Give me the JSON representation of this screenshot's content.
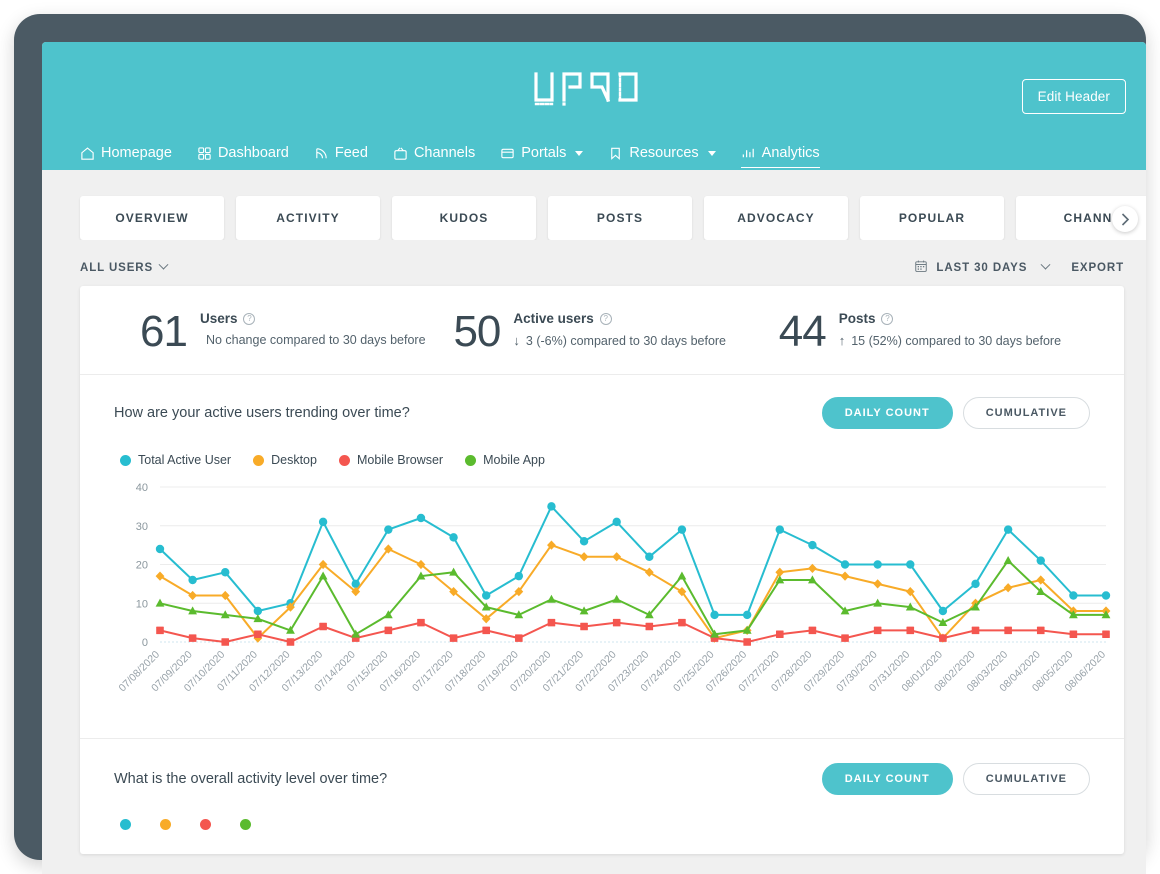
{
  "header": {
    "logo_alt": "OPRO",
    "edit_header_label": "Edit Header",
    "brand_color": "#4ec3cc",
    "nav": [
      {
        "label": "Homepage",
        "icon": "home-icon",
        "active": false,
        "dropdown": false
      },
      {
        "label": "Dashboard",
        "icon": "grid-icon",
        "active": false,
        "dropdown": false
      },
      {
        "label": "Feed",
        "icon": "rss-icon",
        "active": false,
        "dropdown": false
      },
      {
        "label": "Channels",
        "icon": "tv-icon",
        "active": false,
        "dropdown": false
      },
      {
        "label": "Portals",
        "icon": "window-icon",
        "active": false,
        "dropdown": true
      },
      {
        "label": "Resources",
        "icon": "bookmark-icon",
        "active": false,
        "dropdown": true
      },
      {
        "label": "Analytics",
        "icon": "bar-chart-icon",
        "active": true,
        "dropdown": false
      }
    ]
  },
  "tabs": [
    {
      "label": "OVERVIEW",
      "active": true
    },
    {
      "label": "ACTIVITY",
      "active": false
    },
    {
      "label": "KUDOS",
      "active": false
    },
    {
      "label": "POSTS",
      "active": false
    },
    {
      "label": "ADVOCACY",
      "active": false
    },
    {
      "label": "POPULAR",
      "active": false
    },
    {
      "label": "CHANN",
      "active": false
    }
  ],
  "filters": {
    "audience_label": "ALL USERS",
    "date_range_label": "LAST 30 DAYS",
    "export_label": "EXPORT"
  },
  "stats": [
    {
      "value": "61",
      "title": "Users",
      "delta_arrow": "",
      "delta_text": "No change compared to 30 days before"
    },
    {
      "value": "50",
      "title": "Active users",
      "delta_arrow": "↓",
      "delta_text": "3 (-6%) compared to 30 days before"
    },
    {
      "value": "44",
      "title": "Posts",
      "delta_arrow": "↑",
      "delta_text": "15 (52%) compared to 30 days before"
    }
  ],
  "active_users_panel": {
    "question": "How are your active users trending over time?",
    "toggle_daily": "DAILY COUNT",
    "toggle_cumulative": "CUMULATIVE",
    "selected_toggle": "DAILY COUNT"
  },
  "activity_panel": {
    "question": "What is the overall activity level over time?",
    "toggle_daily": "DAILY COUNT",
    "toggle_cumulative": "CUMULATIVE",
    "selected_toggle": "DAILY COUNT"
  },
  "chart_data": {
    "type": "line",
    "title": "How are your active users trending over time?",
    "xlabel": "",
    "ylabel": "",
    "ylim": [
      0,
      40
    ],
    "yticks": [
      0,
      10,
      20,
      30,
      40
    ],
    "grid": true,
    "legend_position": "top-left",
    "x": [
      "07/08/2020",
      "07/09/2020",
      "07/10/2020",
      "07/11/2020",
      "07/12/2020",
      "07/13/2020",
      "07/14/2020",
      "07/15/2020",
      "07/16/2020",
      "07/17/2020",
      "07/18/2020",
      "07/19/2020",
      "07/20/2020",
      "07/21/2020",
      "07/22/2020",
      "07/23/2020",
      "07/24/2020",
      "07/25/2020",
      "07/26/2020",
      "07/27/2020",
      "07/28/2020",
      "07/29/2020",
      "07/30/2020",
      "07/31/2020",
      "08/01/2020",
      "08/02/2020",
      "08/03/2020",
      "08/04/2020",
      "08/05/2020",
      "08/06/2020"
    ],
    "series": [
      {
        "name": "Total Active User",
        "color": "#27bdd0",
        "marker": "circle",
        "values": [
          24,
          16,
          18,
          8,
          10,
          31,
          15,
          29,
          32,
          27,
          12,
          17,
          35,
          26,
          31,
          22,
          29,
          7,
          7,
          29,
          25,
          20,
          20,
          20,
          8,
          15,
          29,
          21,
          12,
          12
        ]
      },
      {
        "name": "Desktop",
        "color": "#f8ab28",
        "marker": "diamond",
        "values": [
          17,
          12,
          12,
          1,
          9,
          20,
          13,
          24,
          20,
          13,
          6,
          13,
          25,
          22,
          22,
          18,
          13,
          1,
          3,
          18,
          19,
          17,
          15,
          13,
          1,
          10,
          14,
          16,
          8,
          8
        ]
      },
      {
        "name": "Mobile Browser",
        "color": "#f4564f",
        "marker": "square",
        "values": [
          3,
          1,
          0,
          2,
          0,
          4,
          1,
          3,
          5,
          1,
          3,
          1,
          5,
          4,
          5,
          4,
          5,
          1,
          0,
          2,
          3,
          1,
          3,
          3,
          1,
          3,
          3,
          3,
          2,
          2
        ]
      },
      {
        "name": "Mobile App",
        "color": "#5bbb2e",
        "marker": "triangle",
        "values": [
          10,
          8,
          7,
          6,
          3,
          17,
          2,
          7,
          17,
          18,
          9,
          7,
          11,
          8,
          11,
          7,
          17,
          2,
          3,
          16,
          16,
          8,
          10,
          9,
          5,
          9,
          21,
          13,
          7,
          7
        ]
      }
    ]
  }
}
